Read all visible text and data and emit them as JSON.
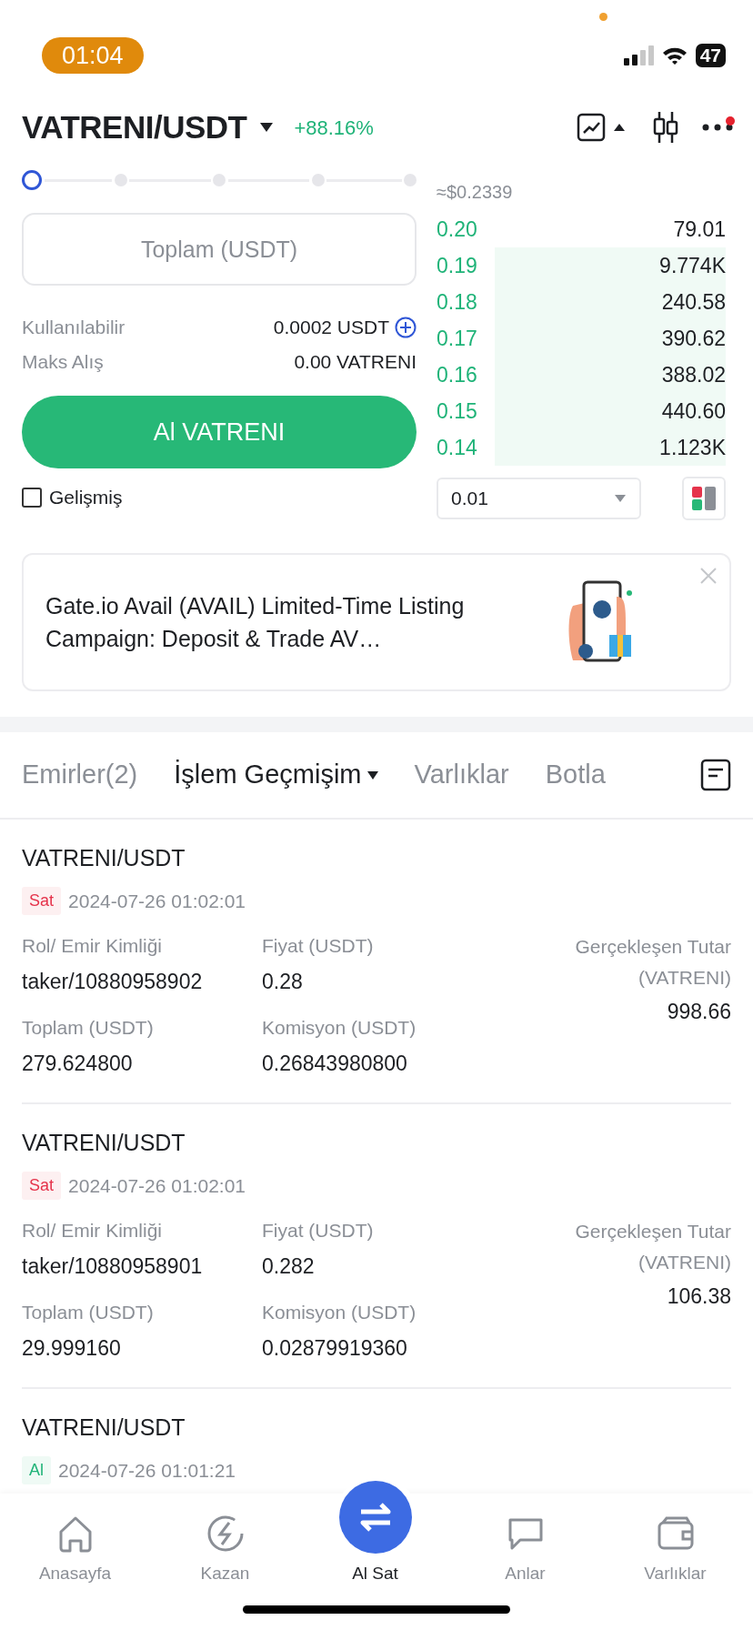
{
  "status_bar": {
    "time": "01:04",
    "battery": "47"
  },
  "header": {
    "pair": "VATRENI/USDT",
    "change": "+88.16%"
  },
  "order_form": {
    "slider": {
      "level": 0
    },
    "total_field": {
      "placeholder": "Toplam (USDT)"
    },
    "available_label": "Kullanılabilir",
    "available_value": "0.0002 USDT",
    "max_buy_label": "Maks Alış",
    "max_buy_value": "0.00 VATRENI",
    "buy_button": "Al VATRENI",
    "advanced": {
      "label": "Gelişmiş",
      "checked": false
    }
  },
  "order_book": {
    "usd_price": "≈$0.2339",
    "rows": [
      {
        "price": "0.20",
        "amount": "79.01"
      },
      {
        "price": "0.19",
        "amount": "9.774K"
      },
      {
        "price": "0.18",
        "amount": "240.58"
      },
      {
        "price": "0.17",
        "amount": "390.62"
      },
      {
        "price": "0.16",
        "amount": "388.02"
      },
      {
        "price": "0.15",
        "amount": "440.60"
      },
      {
        "price": "0.14",
        "amount": "1.123K"
      }
    ],
    "precision": "0.01"
  },
  "promo": {
    "text": "Gate.io Avail (AVAIL) Limited-Time Listing Campaign: Deposit & Trade AV…"
  },
  "tabs": [
    {
      "label": "Emirler(2)",
      "selected": false
    },
    {
      "label": "İşlem Geçmişim",
      "selected": true
    },
    {
      "label": "Varlıklar",
      "selected": false
    },
    {
      "label": "Botla",
      "selected": false
    }
  ],
  "trades": [
    {
      "pair": "VATRENI/USDT",
      "kind": "sell",
      "side_label": "Sat",
      "time": "2024-07-26 01:02:01",
      "role_label": "Rol/ Emir Kimliği",
      "role": "taker/10880958902",
      "price_label": "Fiyat (USDT)",
      "price": "0.28",
      "filled_label": "Gerçekleşen Tutar (VATRENI)",
      "filled": "998.66",
      "total_label": "Toplam (USDT)",
      "total": "279.624800",
      "fee_label": "Komisyon (USDT)",
      "fee": "0.26843980800"
    },
    {
      "pair": "VATRENI/USDT",
      "kind": "sell",
      "side_label": "Sat",
      "time": "2024-07-26 01:02:01",
      "role_label": "Rol/ Emir Kimliği",
      "role": "taker/10880958901",
      "price_label": "Fiyat (USDT)",
      "price": "0.282",
      "filled_label": "Gerçekleşen Tutar (VATRENI)",
      "filled": "106.38",
      "total_label": "Toplam (USDT)",
      "total": "29.999160",
      "fee_label": "Komisyon (USDT)",
      "fee": "0.02879919360"
    },
    {
      "pair": "VATRENI/USDT",
      "kind": "buy",
      "side_label": "Al",
      "time": "2024-07-26 01:01:21"
    }
  ],
  "bottom_nav": [
    {
      "label": "Anasayfa",
      "selected": false
    },
    {
      "label": "Kazan",
      "selected": false
    },
    {
      "label": "Al Sat",
      "selected": true
    },
    {
      "label": "Anlar",
      "selected": false
    },
    {
      "label": "Varlıklar",
      "selected": false
    }
  ]
}
